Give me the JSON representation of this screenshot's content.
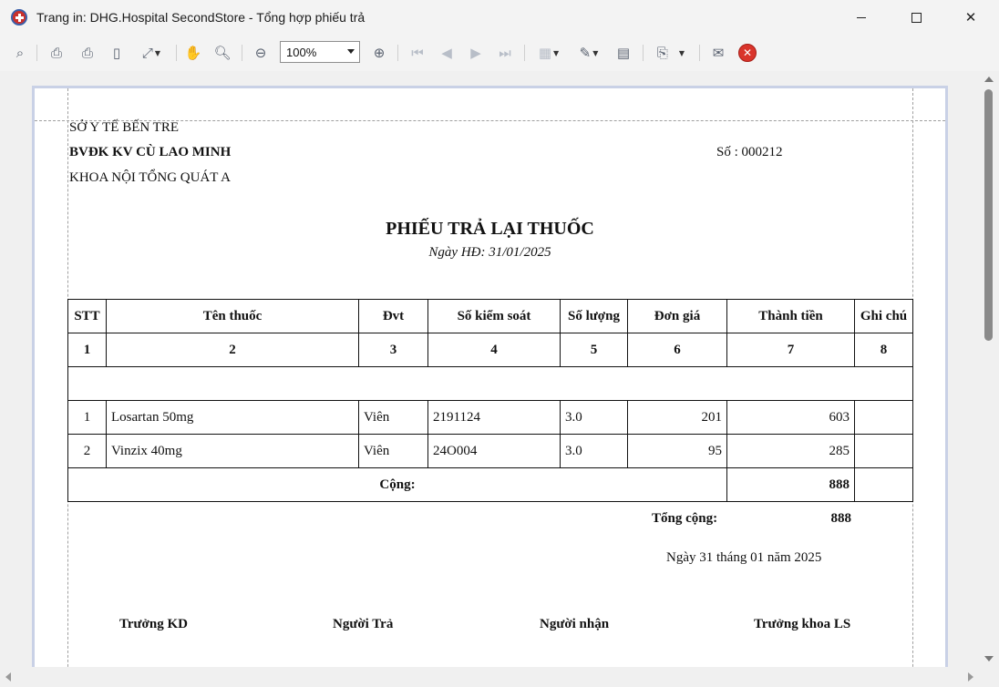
{
  "window": {
    "title": "Trang in: DHG.Hospital SecondStore - Tổng hợp phiếu trả",
    "minimize": "—",
    "maximize": "☐",
    "close": "✕"
  },
  "toolbar": {
    "zoom_value": "100%",
    "icons": [
      "binoculars-icon",
      "print-icon",
      "quick-print-icon",
      "page-setup-icon",
      "scale-icon",
      "hand-icon",
      "magnifier-icon",
      "zoom-out-icon",
      "zoom-in-icon",
      "first-page-icon",
      "prev-page-icon",
      "next-page-icon",
      "last-page-icon",
      "multi-page-icon",
      "color-icon",
      "watermark-icon",
      "export-icon",
      "send-icon",
      "close-preview-icon"
    ]
  },
  "report": {
    "dept_line1": "SỞ Y TẾ BẾN TRE",
    "dept_line2": "BVĐK KV CÙ LAO MINH",
    "dept_line3": "KHOA NỘI TỔNG QUÁT A",
    "doc_number": "Số : 000212",
    "title": "PHIẾU TRẢ LẠI THUỐC",
    "date_line": "Ngày HĐ: 31/01/2025",
    "columns": [
      "STT",
      "Tên thuốc",
      "Đvt",
      "Số kiểm soát",
      "Số lượng",
      "Đơn giá",
      "Thành tiền",
      "Ghi chú"
    ],
    "column_numbers": [
      "1",
      "2",
      "3",
      "4",
      "5",
      "6",
      "7",
      "8"
    ],
    "rows": [
      {
        "stt": "1",
        "name": "Losartan 50mg",
        "unit": "Viên",
        "control": "2191124",
        "qty": "3.0",
        "price": "201",
        "amount": "603",
        "note": ""
      },
      {
        "stt": "2",
        "name": "Vinzix 40mg",
        "unit": "Viên",
        "control": "24O004",
        "qty": "3.0",
        "price": "95",
        "amount": "285",
        "note": ""
      }
    ],
    "subtotal_label": "Cộng:",
    "subtotal_value": "888",
    "total_label": "Tổng cộng:",
    "total_value": "888",
    "sign_date": "Ngày 31 tháng 01 năm 2025",
    "signers": [
      "Trưởng KD",
      "Người Trả",
      "Người nhận",
      "Trưởng khoa LS"
    ]
  }
}
